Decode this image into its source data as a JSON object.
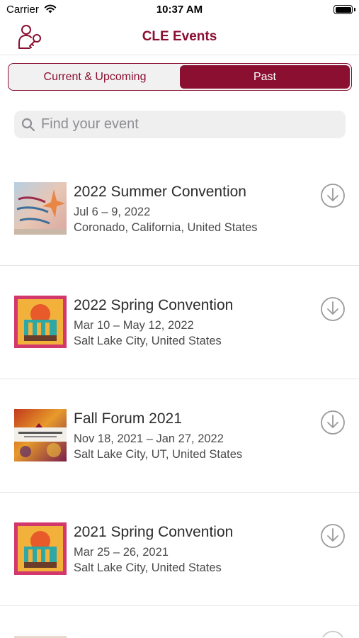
{
  "status_bar": {
    "carrier": "Carrier",
    "time": "10:37 AM"
  },
  "nav": {
    "title": "CLE Events",
    "icon": "user-key-icon"
  },
  "tabs": [
    {
      "label": "Current & Upcoming",
      "selected": false
    },
    {
      "label": "Past",
      "selected": true
    }
  ],
  "search": {
    "placeholder": "Find your event",
    "value": ""
  },
  "events": [
    {
      "title": "2022 Summer Convention",
      "dates": "Jul 6 – 9, 2022",
      "location": "Coronado, California, United States",
      "icon": "download-icon"
    },
    {
      "title": "2022 Spring Convention",
      "dates": "Mar 10 – May 12, 2022",
      "location": "Salt Lake City, United States",
      "icon": "download-icon"
    },
    {
      "title": "Fall Forum 2021",
      "dates": "Nov 18, 2021 – Jan 27, 2022",
      "location": "Salt Lake City, UT, United States",
      "icon": "download-icon"
    },
    {
      "title": "2021 Spring Convention",
      "dates": "Mar 25 – 26, 2021",
      "location": "Salt Lake City, United States",
      "icon": "download-icon"
    }
  ],
  "colors": {
    "accent": "#8a0f31",
    "separator": "#e6e6e6",
    "search_bg": "#efeff0"
  }
}
